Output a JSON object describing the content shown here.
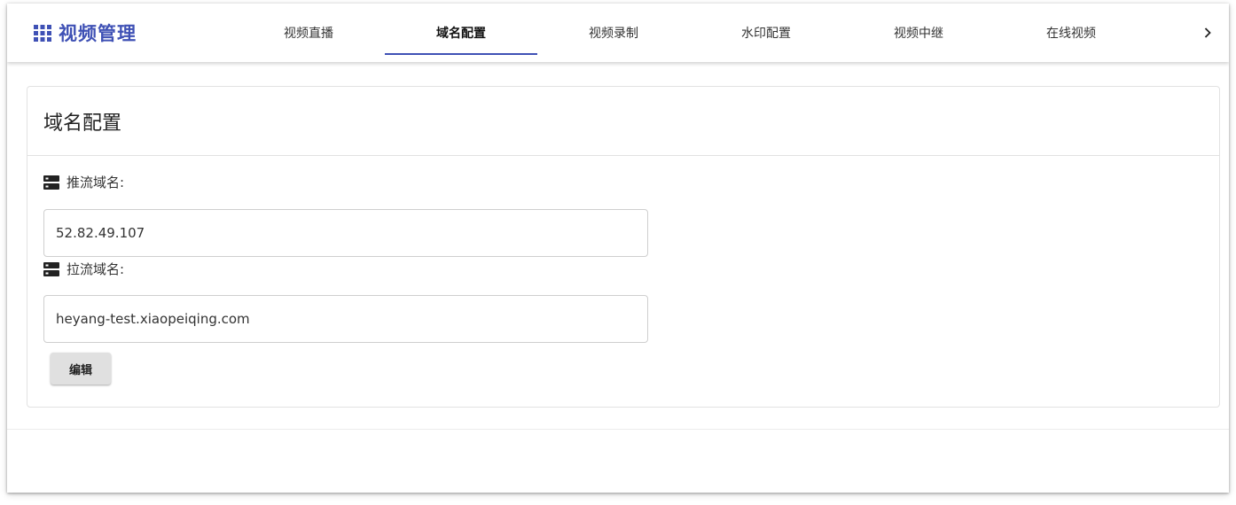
{
  "app": {
    "title": "视频管理",
    "accent_color": "#3f51b5",
    "logo_icon": "apps-grid-icon"
  },
  "nav": {
    "tabs": [
      {
        "label": "视频直播",
        "active": false
      },
      {
        "label": "域名配置",
        "active": true
      },
      {
        "label": "视频录制",
        "active": false
      },
      {
        "label": "水印配置",
        "active": false
      },
      {
        "label": "视频中继",
        "active": false
      },
      {
        "label": "在线视频",
        "active": false
      }
    ],
    "next_icon": "chevron-right-icon"
  },
  "card": {
    "title": "域名配置",
    "push": {
      "label": "推流域名:",
      "value": "52.82.49.107",
      "icon": "dns-icon"
    },
    "pull": {
      "label": "拉流域名:",
      "value": "heyang-test.xiaopeiqing.com",
      "icon": "dns-icon"
    },
    "edit_button": "编辑"
  }
}
